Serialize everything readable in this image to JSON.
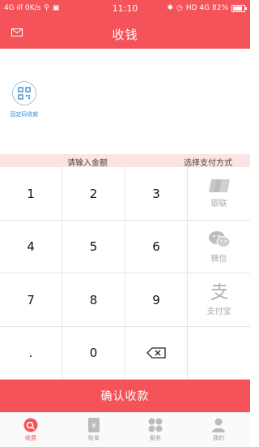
{
  "status_bar": {
    "left_text": "4G ıll 0K/s",
    "time": "11:10",
    "right_text": "HD 4G 82%",
    "battery_level": 0.82
  },
  "header": {
    "title": "收钱",
    "mail_icon": "mail-icon"
  },
  "qr_shortcut": {
    "label": "固定码收款",
    "icon": "qr-code-icon"
  },
  "labels": {
    "amount": "请输入金额",
    "method": "选择支付方式"
  },
  "keypad": {
    "keys": [
      "1",
      "2",
      "3",
      "4",
      "5",
      "6",
      "7",
      "8",
      "9",
      ".",
      "0"
    ],
    "backspace_icon": "backspace-icon"
  },
  "payment_methods": [
    {
      "label": "银联",
      "icon": "unionpay-icon"
    },
    {
      "label": "微信",
      "icon": "wechat-icon"
    },
    {
      "label": "支付宝",
      "icon": "alipay-icon"
    }
  ],
  "confirm_button": "确认收款",
  "tabs": [
    {
      "label": "收费",
      "icon": "collect-icon",
      "active": true
    },
    {
      "label": "账单",
      "icon": "bill-icon",
      "active": false
    },
    {
      "label": "服务",
      "icon": "service-icon",
      "active": false
    },
    {
      "label": "我的",
      "icon": "profile-icon",
      "active": false
    }
  ],
  "colors": {
    "brand_red": "#f45459",
    "label_bg": "#fde4e4",
    "qr_blue": "#3d8fd6"
  }
}
